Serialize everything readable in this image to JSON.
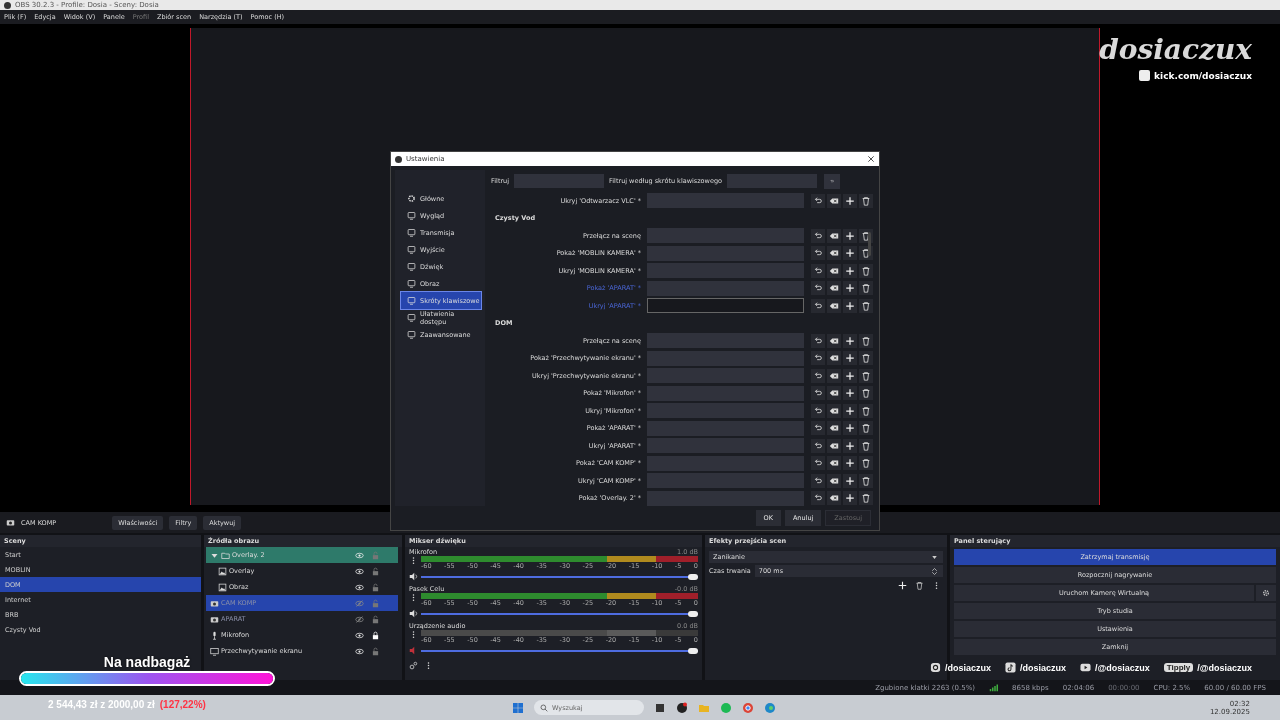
{
  "window": {
    "title": "OBS 30.2.3 - Profile: Dosia - Sceny: Dosia"
  },
  "menu": [
    {
      "label": "Plik (F)",
      "disabled": false
    },
    {
      "label": "Edycja",
      "disabled": false
    },
    {
      "label": "Widok (V)",
      "disabled": false
    },
    {
      "label": "Panele",
      "disabled": false
    },
    {
      "label": "Profil",
      "disabled": true
    },
    {
      "label": "Zbiór scen",
      "disabled": false
    },
    {
      "label": "Narzędzia (T)",
      "disabled": false
    },
    {
      "label": "Pomoc (H)",
      "disabled": false
    }
  ],
  "preview": {
    "logo": "dosiaczux",
    "link": "kick.com/dosiaczux"
  },
  "settings": {
    "title": "Ustawienia",
    "categories": [
      {
        "label": "Główne",
        "selected": false
      },
      {
        "label": "Wygląd",
        "selected": false
      },
      {
        "label": "Transmisja",
        "selected": false
      },
      {
        "label": "Wyjście",
        "selected": false
      },
      {
        "label": "Dźwięk",
        "selected": false
      },
      {
        "label": "Obraz",
        "selected": false
      },
      {
        "label": "Skróty klawiszowe",
        "selected": true
      },
      {
        "label": "Ułatwienia dostępu",
        "selected": false
      },
      {
        "label": "Zaawansowane",
        "selected": false
      }
    ],
    "filter_label": "Filtruj",
    "hotkey_filter_label": "Filtruj według skrótu klawiszowego",
    "hotkeys": [
      {
        "kind": "row",
        "label": "Ukryj 'Odtwarzacz VLC' *",
        "highlighted": false,
        "focused": false
      },
      {
        "kind": "header",
        "label": "Czysty Vod"
      },
      {
        "kind": "row",
        "label": "Przełącz na scenę",
        "highlighted": false,
        "focused": false
      },
      {
        "kind": "row",
        "label": "Pokaż 'MOBLIN KAMERA' *",
        "highlighted": false,
        "focused": false
      },
      {
        "kind": "row",
        "label": "Ukryj 'MOBLIN KAMERA' *",
        "highlighted": false,
        "focused": false
      },
      {
        "kind": "row",
        "label": "Pokaż 'APARAT' *",
        "highlighted": true,
        "focused": false
      },
      {
        "kind": "row",
        "label": "Ukryj 'APARAT' *",
        "highlighted": true,
        "focused": true
      },
      {
        "kind": "header",
        "label": "DOM"
      },
      {
        "kind": "row",
        "label": "Przełącz na scenę",
        "highlighted": false,
        "focused": false
      },
      {
        "kind": "row",
        "label": "Pokaż 'Przechwytywanie ekranu' *",
        "highlighted": false,
        "focused": false
      },
      {
        "kind": "row",
        "label": "Ukryj 'Przechwytywanie ekranu' *",
        "highlighted": false,
        "focused": false
      },
      {
        "kind": "row",
        "label": "Pokaż 'Mikrofon' *",
        "highlighted": false,
        "focused": false
      },
      {
        "kind": "row",
        "label": "Ukryj 'Mikrofon' *",
        "highlighted": false,
        "focused": false
      },
      {
        "kind": "row",
        "label": "Pokaż 'APARAT' *",
        "highlighted": false,
        "focused": false
      },
      {
        "kind": "row",
        "label": "Ukryj 'APARAT' *",
        "highlighted": false,
        "focused": false
      },
      {
        "kind": "row",
        "label": "Pokaż 'CAM KOMP' *",
        "highlighted": false,
        "focused": false
      },
      {
        "kind": "row",
        "label": "Ukryj 'CAM KOMP' *",
        "highlighted": false,
        "focused": false
      },
      {
        "kind": "row",
        "label": "Pokaż 'Overlay. 2' *",
        "highlighted": false,
        "focused": false
      }
    ],
    "buttons": [
      {
        "label": "OK",
        "disabled": false
      },
      {
        "label": "Anuluj",
        "disabled": false
      },
      {
        "label": "Zastosuj",
        "disabled": true
      }
    ]
  },
  "source_bar": {
    "name": "CAM KOMP",
    "buttons": [
      "Właściwości",
      "Filtry",
      "Aktywuj"
    ]
  },
  "scenes": {
    "title": "Sceny",
    "items": [
      {
        "name": "Start",
        "selected": false
      },
      {
        "name": "MOBLIN",
        "selected": false
      },
      {
        "name": "DOM",
        "selected": true
      },
      {
        "name": "Internet",
        "selected": false
      },
      {
        "name": "BRB",
        "selected": false
      },
      {
        "name": "Czysty Vod",
        "selected": false
      }
    ]
  },
  "sources": {
    "title": "Źródła obrazu",
    "items": [
      {
        "name": "Overlay. 2",
        "kind": "group",
        "color": "#2e7a6a",
        "selected": false,
        "visible": true,
        "locked": false,
        "expanded": true,
        "children": [
          {
            "name": "Overlay",
            "kind": "image",
            "selected": false,
            "visible": true,
            "locked": false
          },
          {
            "name": "Obraz",
            "kind": "image",
            "selected": false,
            "visible": true,
            "locked": false
          }
        ]
      },
      {
        "name": "CAM KOMP",
        "kind": "camera",
        "selected": true,
        "visible": false,
        "locked": false
      },
      {
        "name": "APARAT",
        "kind": "camera",
        "selected": false,
        "visible": false,
        "locked": false
      },
      {
        "name": "Mikrofon",
        "kind": "microphone",
        "selected": false,
        "visible": true,
        "locked": true
      },
      {
        "name": "Przechwytywanie ekranu",
        "kind": "display",
        "selected": false,
        "visible": true,
        "locked": false
      }
    ]
  },
  "mixer": {
    "title": "Mikser dźwięku",
    "channels": [
      {
        "name": "Mikrofon",
        "reading": "1.0 dB",
        "muted": false,
        "level": 1,
        "ticks": [
          "-60",
          "-55",
          "-50",
          "-45",
          "-40",
          "-35",
          "-30",
          "-25",
          "-20",
          "-15",
          "-10",
          "-5",
          "0"
        ]
      },
      {
        "name": "Pasek Celu",
        "reading": "-0.0 dB",
        "muted": false,
        "level": 1,
        "ticks": [
          "-60",
          "-55",
          "-50",
          "-45",
          "-40",
          "-35",
          "-30",
          "-25",
          "-20",
          "-15",
          "-10",
          "-5",
          "0"
        ]
      },
      {
        "name": "Urządzenie audio",
        "reading": "0.0 dB",
        "muted": true,
        "level": 1,
        "ticks": [
          "-60",
          "-55",
          "-50",
          "-45",
          "-40",
          "-35",
          "-30",
          "-25",
          "-20",
          "-15",
          "-10",
          "-5",
          "0"
        ]
      }
    ]
  },
  "transitions": {
    "title": "Efekty przejścia scen",
    "selected": "Zanikanie",
    "duration_label": "Czas trwania",
    "duration": "700 ms"
  },
  "controls": {
    "title": "Panel sterujący",
    "buttons": [
      {
        "label": "Zatrzymaj transmisję",
        "active": true,
        "settings": false
      },
      {
        "label": "Rozpocznij nagrywanie",
        "active": false,
        "settings": false
      },
      {
        "label": "Uruchom Kamerę Wirtualną",
        "active": false,
        "settings": true
      },
      {
        "label": "Tryb studia",
        "active": false,
        "settings": false
      },
      {
        "label": "Ustawienia",
        "active": false,
        "settings": false
      },
      {
        "label": "Zamknij",
        "active": false,
        "settings": false
      }
    ]
  },
  "status_bar": {
    "dropped": "Zgubione klatki 2263 (0.5%)",
    "bitrate": "8658 kbps",
    "stream_time": "02:04:06",
    "record_time": "00:00:00",
    "cpu": "CPU: 2.5%",
    "fps": "60.00 / 60.00 FPS"
  },
  "overlay": {
    "goal_title": "Na nadbagaż",
    "level": 1,
    "raised": "2 544,43 zł z 2000,00 zł",
    "percent": "(127,22%)",
    "socials": [
      {
        "kind": "instagram",
        "handle": "/dosiaczux"
      },
      {
        "kind": "tiktok",
        "handle": "/dosiaczux"
      },
      {
        "kind": "youtube",
        "handle": "/@dosiaczux"
      },
      {
        "kind": "tipply",
        "badge": "Tipply",
        "handle": "/@dosiaczux"
      }
    ]
  },
  "taskbar": {
    "search_placeholder": "Wyszukaj",
    "time": "02:32",
    "date": "12.09.2025"
  }
}
